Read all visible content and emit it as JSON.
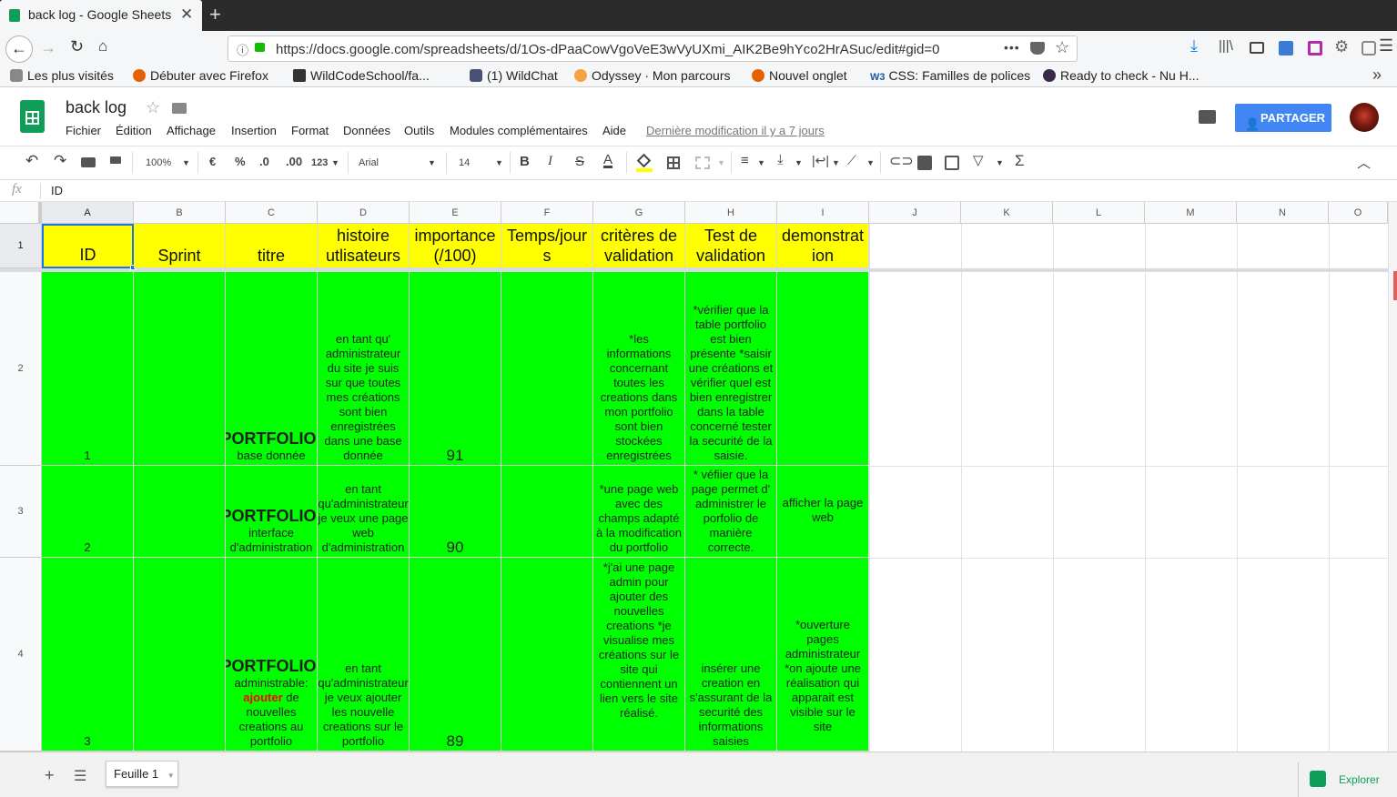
{
  "browser": {
    "tab_title": "back log - Google Sheets",
    "url": "https://docs.google.com/spreadsheets/d/1Os-dPaaCowVgoVeE3wVyUXmi_AIK2Be9hYco2HrASuc/edit#gid=0",
    "url_more": "•••",
    "bookmarks": [
      {
        "label": "Les plus visités",
        "color": "#888888"
      },
      {
        "label": "Débuter avec Firefox",
        "color": "#e66000"
      },
      {
        "label": "WildCodeSchool/fa...",
        "color": "#333333"
      },
      {
        "label": "(1) WildChat",
        "color": "#4a5078"
      },
      {
        "label": "Odyssey · Mon parcours",
        "color": "#f4a340"
      },
      {
        "label": "Nouvel onglet",
        "color": "#e66000"
      },
      {
        "label": "CSS: Familles de polices",
        "color": "#1a5aa0"
      },
      {
        "label": "Ready to check - Nu H...",
        "color": "#3a2a4a"
      }
    ],
    "bookmarks_w3_badge": "W3"
  },
  "app": {
    "doc_title": "back log",
    "menu": [
      "Fichier",
      "Édition",
      "Affichage",
      "Insertion",
      "Format",
      "Données",
      "Outils",
      "Modules complémentaires",
      "Aide"
    ],
    "last_edit": "Dernière modification il y a 7 jours",
    "share_label": "PARTAGER",
    "accent": "#4285f4"
  },
  "toolbar": {
    "zoom": "100%",
    "currency": "€",
    "percent": "%",
    "dec_less": ".0",
    "dec_more": ".00",
    "more_formats": "123",
    "font": "Arial",
    "font_size": "14",
    "bold": "B",
    "italic": "I",
    "strike": "S",
    "text_color": "A",
    "sigma": "Σ"
  },
  "formula_bar": {
    "fx": "fx",
    "value": "ID"
  },
  "grid": {
    "columns": [
      "A",
      "B",
      "C",
      "D",
      "E",
      "F",
      "G",
      "H",
      "I",
      "J",
      "K",
      "L",
      "M",
      "N",
      "O"
    ],
    "rows": [
      "1",
      "2",
      "3",
      "4"
    ],
    "header": [
      "ID",
      "Sprint",
      "titre",
      "histoire utlisateurs",
      "importance (/100)",
      "Temps/jours",
      "critères de validation",
      "Test de validation",
      "demonstration"
    ],
    "body": [
      {
        "id": "1",
        "sprint": "",
        "title_bold": "PORTFOLIO:",
        "title_rest": " base donnée",
        "title_red": "",
        "title_tail": "",
        "story": "en tant qu' administrateur du site je suis sur que toutes mes créations sont bien enregistrées dans une base donnée",
        "importance": "91",
        "time": "",
        "criteria": "*les informations concernant toutes les creations dans mon portfolio sont bien stockées enregistrées",
        "test": "*vérifier que la table portfolio est bien présente *saisir une créations et vérifier quel est bien enregistrer dans la table concerné tester la securité de la saisie.",
        "demo": ""
      },
      {
        "id": "2",
        "sprint": "",
        "title_bold": "PORTFOLIO:",
        "title_rest": " interface d'administration",
        "title_red": "",
        "title_tail": "",
        "story": "en tant qu'administrateur je veux une page web d'administration",
        "importance": "90",
        "time": "",
        "criteria": "*une page web avec des champs adapté à la modification du portfolio",
        "test": "* véfiier que la page permet d' administrer le porfolio de manière correcte.",
        "demo": "afficher la page web"
      },
      {
        "id": "3",
        "sprint": "",
        "title_bold": "PORTFOLIO:",
        "title_rest": " administrable: ",
        "title_red": "ajouter",
        "title_tail": " de nouvelles creations au portfolio",
        "story": "en tant qu'administrateur je veux ajouter les nouvelle creations sur le portfolio",
        "importance": "89",
        "time": "",
        "criteria": "*j'ai une page admin pour ajouter des nouvelles creations *je visualise mes créations sur le site qui contiennent un lien vers le site réalisé.",
        "test": "insérer une creation en s'assurant de la securité des informations saisies",
        "demo": "*ouverture pages administrateur *on ajoute une réalisation qui apparait est visible sur le site"
      }
    ],
    "header_fill": "#ffff00",
    "body_fill": "#00ff00"
  },
  "bottom": {
    "sheet_tab": "Feuille 1",
    "explore": "Explorer"
  }
}
